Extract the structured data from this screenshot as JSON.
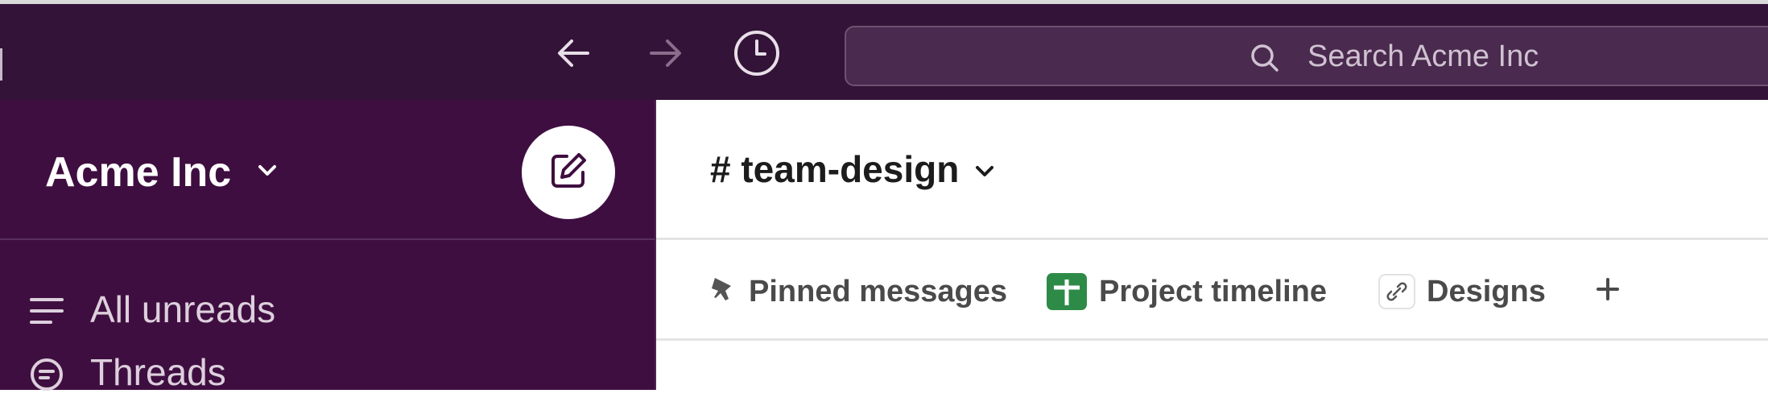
{
  "topbar": {
    "back_icon": "arrow-left-icon",
    "forward_icon": "arrow-right-icon",
    "history_icon": "clock-icon",
    "search_placeholder": "Search Acme Inc"
  },
  "sidebar": {
    "workspace_name": "Acme Inc",
    "compose_icon": "compose-icon",
    "items": [
      {
        "label": "All unreads",
        "icon": "lines-icon"
      },
      {
        "label": "Threads",
        "icon": "threads-icon"
      }
    ]
  },
  "channel": {
    "name": "# team-design",
    "bookmarks": [
      {
        "label": "Pinned messages",
        "icon": "pin-icon"
      },
      {
        "label": "Project timeline",
        "icon": "spreadsheet-icon"
      },
      {
        "label": "Designs",
        "icon": "link-icon"
      }
    ],
    "add_bookmark": "+"
  },
  "colors": {
    "topbar": "#331337",
    "sidebar": "#3f0e40",
    "spreadsheet_green": "#2e8b47"
  }
}
